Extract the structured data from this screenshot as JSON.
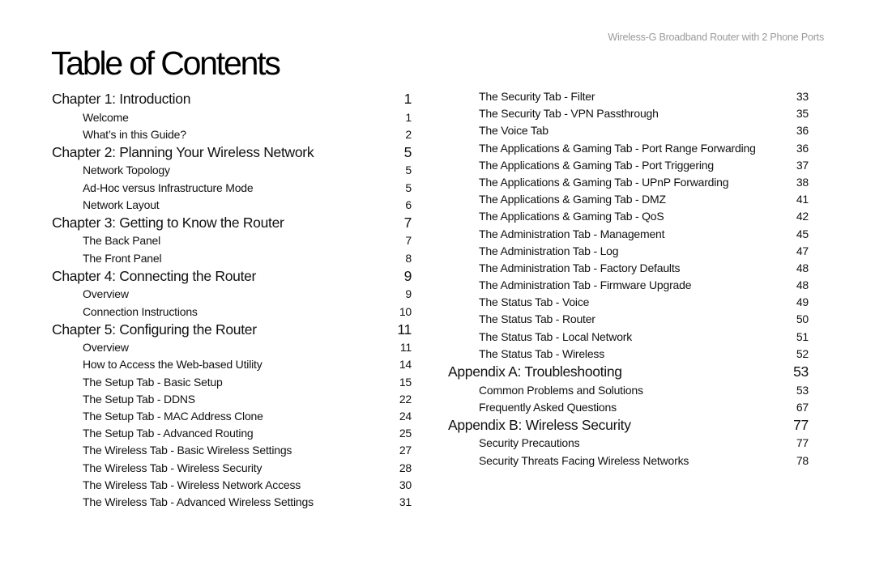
{
  "header": {
    "product_title": "Wireless-G Broadband Router with 2 Phone Ports"
  },
  "page_title": "Table of Contents",
  "toc": {
    "left_column": [
      {
        "type": "chapter",
        "title": "Chapter 1: Introduction",
        "page": "1"
      },
      {
        "type": "section",
        "title": "Welcome",
        "page": "1"
      },
      {
        "type": "section",
        "title": "What’s in this Guide?",
        "page": "2"
      },
      {
        "type": "chapter",
        "title": "Chapter 2: Planning Your Wireless Network",
        "page": "5"
      },
      {
        "type": "section",
        "title": "Network Topology",
        "page": "5"
      },
      {
        "type": "section",
        "title": "Ad-Hoc versus Infrastructure Mode",
        "page": "5"
      },
      {
        "type": "section",
        "title": "Network Layout",
        "page": "6"
      },
      {
        "type": "chapter",
        "title": "Chapter 3: Getting to Know the Router",
        "page": "7"
      },
      {
        "type": "section",
        "title": "The Back Panel",
        "page": "7"
      },
      {
        "type": "section",
        "title": "The Front Panel",
        "page": "8"
      },
      {
        "type": "chapter",
        "title": "Chapter 4: Connecting the Router",
        "page": "9"
      },
      {
        "type": "section",
        "title": "Overview",
        "page": "9"
      },
      {
        "type": "section",
        "title": "Connection Instructions",
        "page": "10"
      },
      {
        "type": "chapter",
        "title": "Chapter 5: Configuring the Router",
        "page": "11"
      },
      {
        "type": "section",
        "title": "Overview",
        "page": "11"
      },
      {
        "type": "section",
        "title": "How to Access the Web-based Utility",
        "page": "14"
      },
      {
        "type": "section",
        "title": "The Setup Tab - Basic Setup",
        "page": "15"
      },
      {
        "type": "section",
        "title": "The Setup Tab - DDNS",
        "page": "22"
      },
      {
        "type": "section",
        "title": "The Setup Tab - MAC Address Clone",
        "page": "24"
      },
      {
        "type": "section",
        "title": "The Setup Tab - Advanced Routing",
        "page": "25"
      },
      {
        "type": "section",
        "title": "The Wireless Tab - Basic Wireless Settings",
        "page": "27"
      },
      {
        "type": "section",
        "title": "The Wireless Tab - Wireless Security",
        "page": "28"
      },
      {
        "type": "section",
        "title": "The Wireless Tab - Wireless Network Access",
        "page": "30"
      },
      {
        "type": "section",
        "title": "The Wireless Tab - Advanced Wireless Settings",
        "page": "31"
      }
    ],
    "right_column": [
      {
        "type": "section",
        "title": "The Security Tab - Filter",
        "page": "33"
      },
      {
        "type": "section",
        "title": "The Security Tab - VPN Passthrough",
        "page": "35"
      },
      {
        "type": "section",
        "title": "The Voice Tab",
        "page": "36"
      },
      {
        "type": "section",
        "title": "The Applications & Gaming Tab - Port Range Forwarding",
        "page": "36"
      },
      {
        "type": "section",
        "title": "The Applications & Gaming Tab - Port Triggering",
        "page": "37"
      },
      {
        "type": "section",
        "title": "The Applications & Gaming Tab - UPnP Forwarding",
        "page": "38"
      },
      {
        "type": "section",
        "title": "The Applications & Gaming Tab - DMZ",
        "page": "41"
      },
      {
        "type": "section",
        "title": "The Applications & Gaming Tab - QoS",
        "page": "42"
      },
      {
        "type": "section",
        "title": "The Administration Tab - Management",
        "page": "45"
      },
      {
        "type": "section",
        "title": "The Administration Tab - Log",
        "page": "47"
      },
      {
        "type": "section",
        "title": "The Administration Tab - Factory Defaults",
        "page": "48"
      },
      {
        "type": "section",
        "title": "The Administration Tab - Firmware Upgrade",
        "page": "48"
      },
      {
        "type": "section",
        "title": "The Status Tab - Voice",
        "page": "49"
      },
      {
        "type": "section",
        "title": "The Status Tab - Router",
        "page": "50"
      },
      {
        "type": "section",
        "title": "The Status Tab - Local Network",
        "page": "51"
      },
      {
        "type": "section",
        "title": "The Status Tab - Wireless",
        "page": "52"
      },
      {
        "type": "chapter",
        "title": "Appendix A: Troubleshooting",
        "page": "53"
      },
      {
        "type": "section",
        "title": "Common Problems and Solutions",
        "page": "53"
      },
      {
        "type": "section",
        "title": "Frequently Asked Questions",
        "page": "67"
      },
      {
        "type": "chapter",
        "title": "Appendix B: Wireless Security",
        "page": "77"
      },
      {
        "type": "section",
        "title": "Security Precautions",
        "page": "77"
      },
      {
        "type": "section",
        "title": "Security Threats Facing Wireless Networks",
        "page": "78"
      }
    ]
  }
}
